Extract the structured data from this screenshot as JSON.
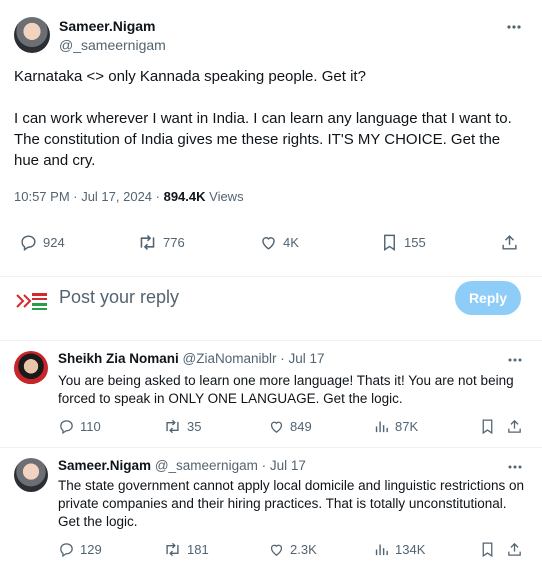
{
  "main_tweet": {
    "author_name": "Sameer.Nigam",
    "handle": "@_sameernigam",
    "text": "Karnataka <> only Kannada speaking people. Get it?\n\nI can work wherever I want in India. I can learn any language that I want to. The constitution of India gives me these rights.  IT'S MY CHOICE. Get the hue and cry.",
    "time": "10:57 PM · Jul 17, 2024 · ",
    "views_count": "894.4K",
    "views_label": " Views",
    "replies": "924",
    "reposts": "776",
    "likes": "4K",
    "bookmarks": "155",
    "icons": [
      "reply-icon",
      "repost-icon",
      "like-icon",
      "bookmark-icon",
      "share-icon",
      "more-icon"
    ]
  },
  "compose": {
    "placeholder": "Post your reply",
    "reply_button": "Reply"
  },
  "replies": [
    {
      "author_name": "Sheikh Zia Nomani",
      "handle_date": "@ZiaNomaniblr · Jul 17",
      "text": "You are being asked to learn one more language! Thats it! You are not being forced to speak in ONLY ONE LANGUAGE. Get the logic.",
      "replies": "110",
      "reposts": "35",
      "likes": "849",
      "views": "87K"
    },
    {
      "author_name": "Sameer.Nigam",
      "handle_date": "@_sameernigam · Jul 17",
      "text": "The state government cannot apply local domicile and linguistic restrictions on private companies and their hiring practices. That is totally unconstitutional. Get the logic.",
      "replies": "129",
      "reposts": "181",
      "likes": "2.3K",
      "views": "134K"
    }
  ],
  "colors": {
    "text": "#0f1419",
    "muted": "#536471",
    "accent_disabled": "#8ecdf8",
    "divider": "#eff3f4"
  }
}
